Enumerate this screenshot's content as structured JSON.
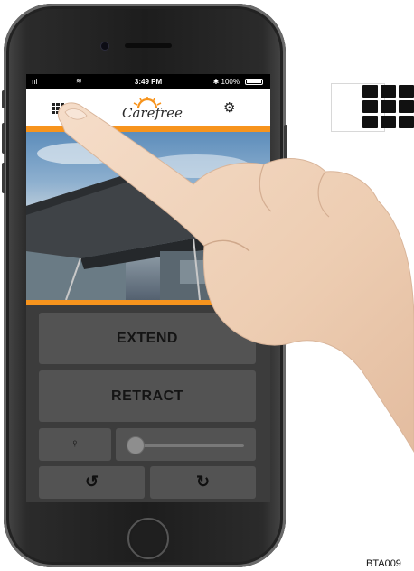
{
  "status_bar": {
    "signal": "ııl",
    "wifi": "≋",
    "time": "3:49 PM",
    "battery": "✱ 100%"
  },
  "app": {
    "logo_text": "Carefree",
    "menu_icon": "grid-menu-icon",
    "settings_icon": "gear-icon",
    "brand_color": "#f7941d",
    "buttons": {
      "extend": "EXTEND",
      "retract": "RETRACT"
    },
    "controls": {
      "light_icon": "light-bulb-icon",
      "dimmer_level": 0.05,
      "rotate_left_icon": "rotate-left-icon",
      "rotate_right_icon": "rotate-right-icon"
    }
  },
  "callout_icon": "grid-menu-icon",
  "figure_code": "BTA009"
}
